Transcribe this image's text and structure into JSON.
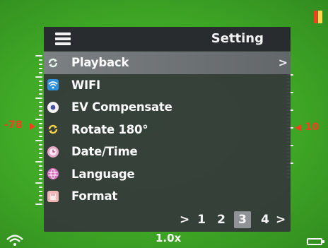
{
  "menu": {
    "title": "Setting",
    "items": [
      {
        "label": "Playback",
        "icon": "rotate-arrows-icon",
        "selected": true
      },
      {
        "label": "WIFI",
        "icon": "wifi-icon",
        "selected": false
      },
      {
        "label": "EV Compensate",
        "icon": "ev-icon",
        "selected": false
      },
      {
        "label": "Rotate 180°",
        "icon": "rotate-arrows-icon",
        "selected": false
      },
      {
        "label": "Date/Time",
        "icon": "clock-icon",
        "selected": false
      },
      {
        "label": "Language",
        "icon": "globe-icon",
        "selected": false
      },
      {
        "label": "Format",
        "icon": "sd-card-icon",
        "selected": false
      }
    ],
    "selected_arrow": ">"
  },
  "pagination": {
    "prev": ">",
    "pages": [
      "1",
      "2",
      "3",
      "4"
    ],
    "current": "3",
    "next": ">"
  },
  "readouts": {
    "left": "-78",
    "right": "10"
  },
  "status": {
    "zoom": "1.0x"
  },
  "colors": {
    "background": "#3fa826",
    "panel": "#34383a",
    "selected_row": "#6c7174",
    "readout": "#ff3b1f",
    "text": "#ffffff"
  }
}
